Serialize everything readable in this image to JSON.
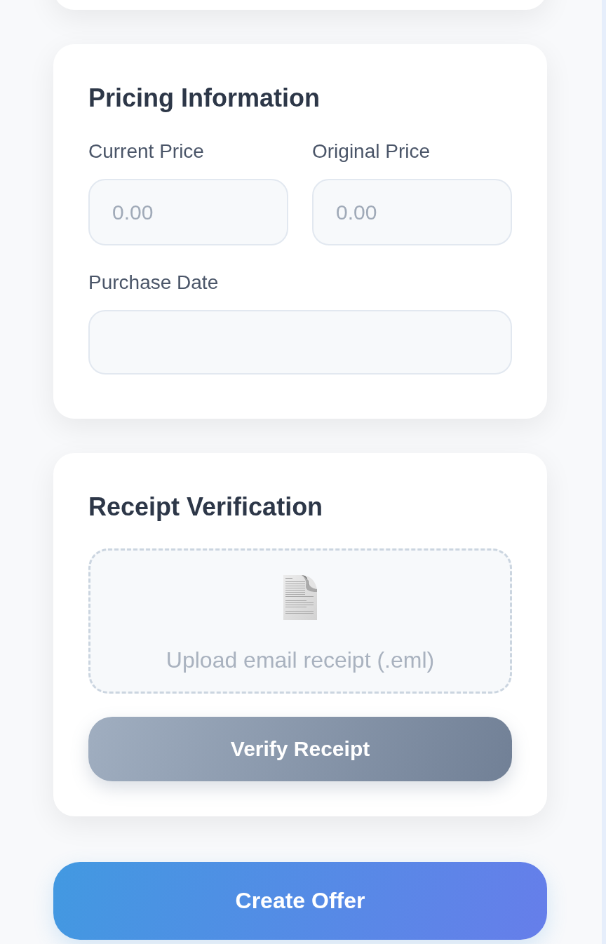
{
  "pricing": {
    "title": "Pricing Information",
    "fields": [
      {
        "label": "Current Price",
        "placeholder": "0.00"
      },
      {
        "label": "Original Price",
        "placeholder": "0.00"
      },
      {
        "label": "Purchase Date"
      }
    ]
  },
  "receipt": {
    "title": "Receipt Verification",
    "upload": {
      "label": "Upload email receipt (.eml)"
    },
    "button": "Verify Receipt"
  },
  "submit_button": "Create Offer"
}
